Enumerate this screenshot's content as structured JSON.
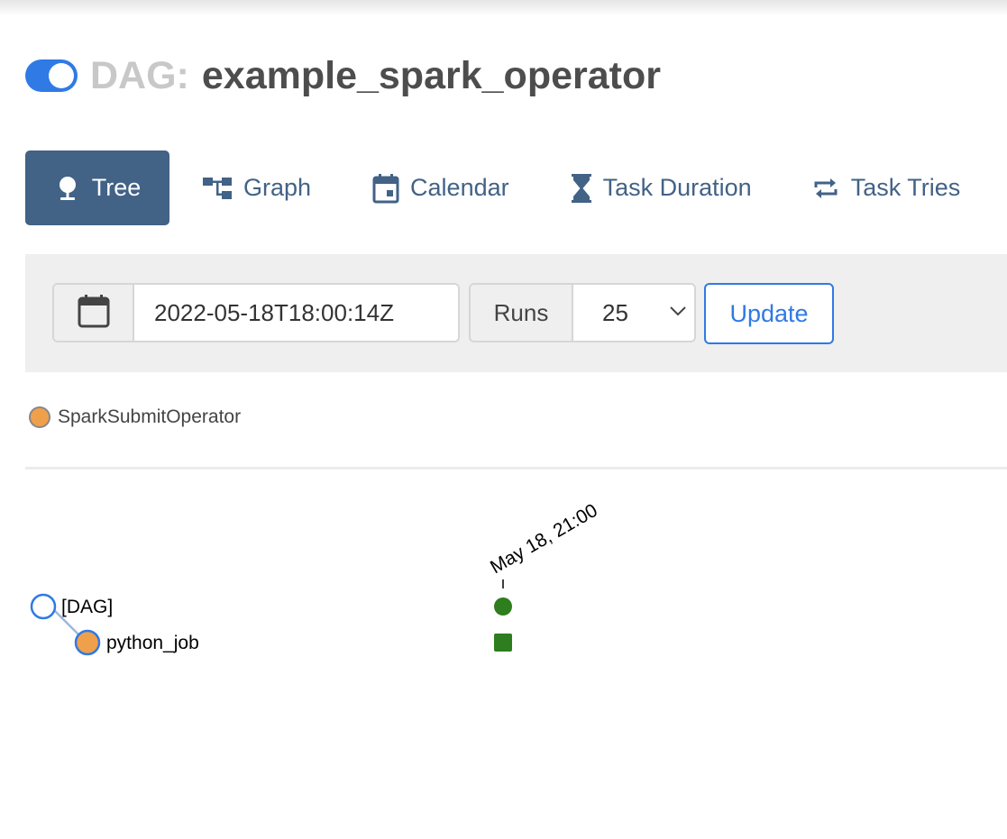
{
  "header": {
    "dag_prefix": "DAG:",
    "dag_name": "example_spark_operator",
    "toggle_state": "on"
  },
  "tabs": [
    {
      "label": "Tree",
      "icon": "tree-icon",
      "active": true
    },
    {
      "label": "Graph",
      "icon": "graph-icon",
      "active": false
    },
    {
      "label": "Calendar",
      "icon": "calendar-icon",
      "active": false
    },
    {
      "label": "Task Duration",
      "icon": "hourglass-icon",
      "active": false
    },
    {
      "label": "Task Tries",
      "icon": "retry-icon",
      "active": false
    }
  ],
  "filter": {
    "base_date": "2022-05-18T18:00:14Z",
    "runs_label": "Runs",
    "runs_value": "25",
    "update_label": "Update"
  },
  "legend": [
    {
      "label": "SparkSubmitOperator",
      "color": "#f0a04b"
    }
  ],
  "tree": {
    "root_label": "[DAG]",
    "task_label": "python_job",
    "run_date_label": "May 18, 21:00",
    "run_state_color": "#2e7d1e",
    "task_state_color": "#2e7d1e"
  },
  "colors": {
    "accent": "#2f7ae5",
    "tab_active_bg": "#426286",
    "tab_text": "#426286",
    "operator": "#f0a04b",
    "success": "#2e7d1e"
  }
}
